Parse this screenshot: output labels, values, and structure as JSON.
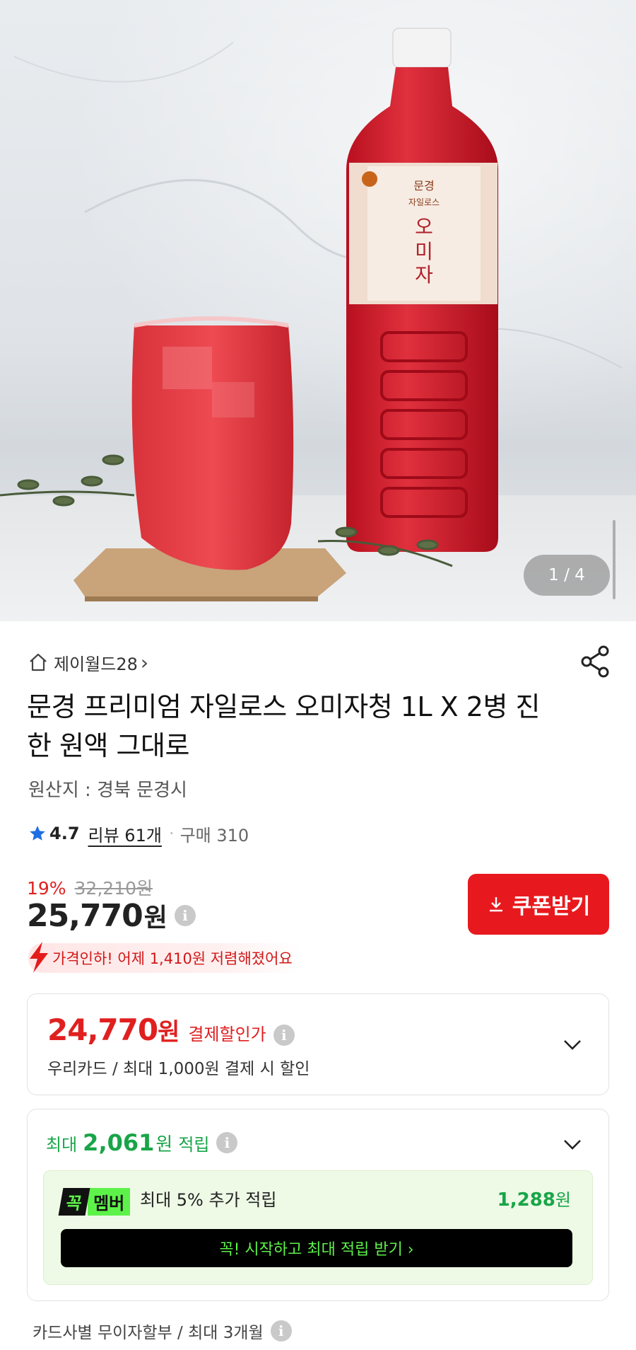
{
  "hero": {
    "counter": "1 / 4"
  },
  "seller": {
    "name": "제이월드28",
    "arrow": "›"
  },
  "product": {
    "title": "문경 프리미엄 자일로스 오미자청 1L X 2병 진한 원액 그대로",
    "origin": "원산지 : 경북 문경시",
    "rating": "4.7",
    "reviews": "리뷰 61개",
    "purchases": "구매 310"
  },
  "pricing": {
    "discount_rate": "19%",
    "original_price": "32,210원",
    "price": "25,770",
    "price_unit": "원",
    "coupon_button": "쿠폰받기",
    "price_drop_notice": "가격인하! 어제 1,410원 저렴해졌어요"
  },
  "card_payment": {
    "price": "24,770",
    "unit": "원",
    "label": "결제할인가",
    "description": "우리카드 / 최대 1,000원 결제 시 할인"
  },
  "points": {
    "prefix": "최대",
    "amount": "2,061",
    "unit": "원",
    "suffix": "적립",
    "member_tag_k": "꼭",
    "member_tag_m": "멤버",
    "member_text": "최대 5% 추가 적립",
    "member_points": "1,288",
    "member_points_unit": "원",
    "member_cta": "꼭! 시작하고 최대 적립 받기 ›"
  },
  "installment": {
    "text": "카드사별 무이자할부 / 최대 3개월"
  },
  "colors": {
    "accent_red": "#e8191e",
    "green": "#18a548",
    "member_green": "#5df24a"
  }
}
